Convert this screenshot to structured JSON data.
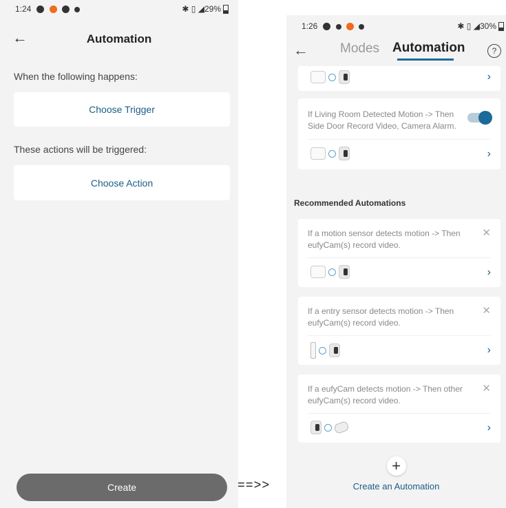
{
  "left": {
    "status": {
      "time": "1:24",
      "right": "29%"
    },
    "header": {
      "title": "Automation"
    },
    "trigger_section_label": "When the following happens:",
    "trigger_button": "Choose Trigger",
    "action_section_label": "These actions will be triggered:",
    "action_button": "Choose Action",
    "create_button": "Create"
  },
  "transition_text": "==>>",
  "right": {
    "status": {
      "time": "1:26",
      "right": "30%"
    },
    "tabs": {
      "modes": "Modes",
      "automation": "Automation"
    },
    "help_icon_label": "?",
    "existing": [
      {
        "text": ""
      },
      {
        "text": "If Living Room Detected Motion -> Then Side Door Record Video, Camera Alarm.",
        "enabled": true
      }
    ],
    "recommended_title": "Recommended Automations",
    "recommended": [
      {
        "text": "If a motion sensor detects motion -> Then eufyCam(s) record video."
      },
      {
        "text": "If a entry sensor detects motion -> Then eufyCam(s)  record video."
      },
      {
        "text": "If a eufyCam detects motion -> Then other eufyCam(s)  record video."
      }
    ],
    "create_automation": {
      "icon": "+",
      "label": "Create an Automation"
    }
  },
  "colors": {
    "accent": "#1a5d85",
    "toggle_on": "#1a6a9a",
    "create_button_bg": "#6b6b6b"
  }
}
